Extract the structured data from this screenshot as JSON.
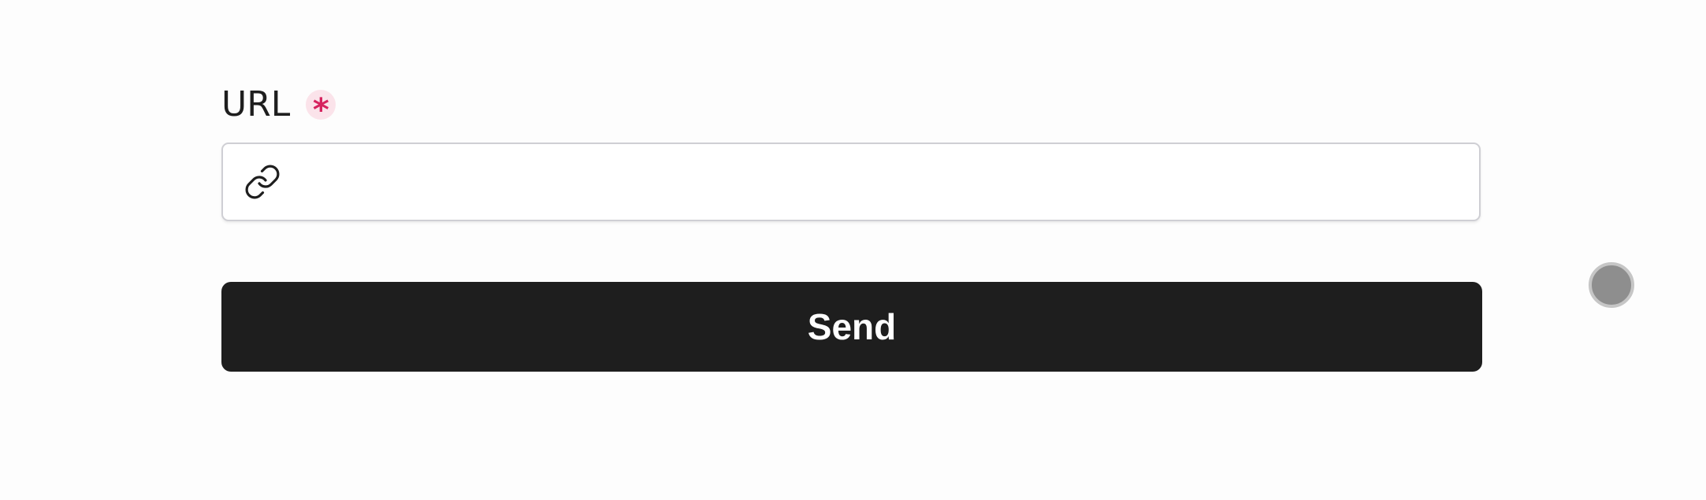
{
  "form": {
    "url_field": {
      "label": "URL",
      "required_marker": "*",
      "value": "",
      "placeholder": "",
      "icon": "link-icon"
    },
    "submit_label": "Send"
  },
  "colors": {
    "text": "#1e1e1e",
    "required_accent": "#d6235f",
    "required_bg": "#fbe3ea",
    "button_bg": "#1e1e1e",
    "button_text": "#ffffff",
    "input_border": "#cfcfd4",
    "page_bg": "#fdfdfd"
  }
}
